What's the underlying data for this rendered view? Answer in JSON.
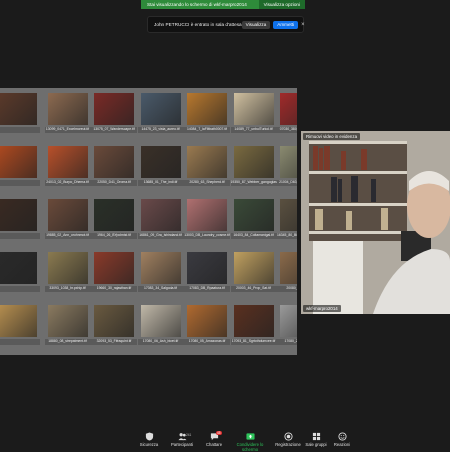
{
  "share_banner": {
    "status_text": "Stai visualizzando lo schermo di wkf-marpro2014",
    "options_label": "Visualizza opzioni"
  },
  "toast": {
    "message": "John PETRUCCI è entrato in sala d'attesa",
    "view_label": "Visualizza",
    "admit_label": "Ammetti",
    "close_glyph": "×"
  },
  "shared_screen": {
    "thumbnails": [
      {
        "cap": "",
        "stars": "",
        "color": "#5c3a2a"
      },
      {
        "cap": "13099_0471_Excelmoreut.tif",
        "stars": "",
        "color": "#8c6a50"
      },
      {
        "cap": "13075_07_Wanderscape.tif",
        "stars": "",
        "color": "#7a2a26"
      },
      {
        "cap": "14475_23_vista_aureo.tif",
        "stars": "",
        "color": "#4a5a6a"
      },
      {
        "cap": "14084_7_laFlitbath0007.tif",
        "stars": "",
        "color": "#b8782e"
      },
      {
        "cap": "14089_77_unbulTurkol.tif",
        "stars": "",
        "color": "#d0c0a0"
      },
      {
        "cap": "07030_380_UFGheoelin.tif",
        "stars": "",
        "color": "#a02a2a"
      },
      {
        "cap": "",
        "stars": "",
        "color": "#b04a20"
      },
      {
        "cap": "24013_02_Burpo_Dhema.tif",
        "stars": "",
        "color": "#b8502a"
      },
      {
        "cap": "22050_D41_Oroma.tif",
        "stars": "",
        "color": "#6a4a3a"
      },
      {
        "cap": "13685_01_The_indi.tif",
        "stars": "",
        "color": "#3a3028"
      },
      {
        "cap": "20280_63_Shepherd.tif",
        "stars": "",
        "color": "#9a7a50"
      },
      {
        "cap": "19350_87_Webber_gangoglas.tif",
        "stars": "",
        "color": "#7a6a40"
      },
      {
        "cap": "21004_D63_Kingpotmatc.tif",
        "stars": "",
        "color": "#8a8a70"
      },
      {
        "cap": "",
        "stars": "",
        "color": "#3a2a22"
      },
      {
        "cap": "19885_02_Ann_orohnmot.tif",
        "stars": "",
        "color": "#6a4a3a"
      },
      {
        "cap": "1964_26_BYpolmist.tif",
        "stars": "",
        "color": "#2a3028"
      },
      {
        "cap": "16861_09_Gra_ishindand.tif",
        "stars": "",
        "color": "#6a4a4a"
      },
      {
        "cap": "13003_DB_Laundry_cosme.tif",
        "stars": "",
        "color": "#b07070"
      },
      {
        "cap": "16403_84_Coltamanigal.tif",
        "stars": "",
        "color": "#3a4a38"
      },
      {
        "cap": "16345_80_Bloom_openhenge.tif",
        "stars": "",
        "color": "#5a5040"
      },
      {
        "cap": "",
        "stars": "",
        "color": "#2a2a2a"
      },
      {
        "cap": "33093_1038_hr.pxhip.tif",
        "stars": "",
        "color": "#8a7a50"
      },
      {
        "cap": "19660_30_rajasthan.tif",
        "stars": "",
        "color": "#8a3a2a"
      },
      {
        "cap": "17083_34_Salgoda.tif",
        "stars": "",
        "color": "#a08060"
      },
      {
        "cap": "17083_DB_Rpaatura.tif",
        "stars": "",
        "color": "#3a3a40"
      },
      {
        "cap": "20003_46_Prop_Sat.tif",
        "stars": "",
        "color": "#c0a060"
      },
      {
        "cap": "20080_02_OAP.tif",
        "stars": "",
        "color": "#8a6a4a"
      },
      {
        "cap": "",
        "stars": "",
        "color": "#b89050"
      },
      {
        "cap": "18880_08_strepatment.tif",
        "stars": "",
        "color": "#8a7a60"
      },
      {
        "cap": "32093_53_Fifraquint.tif",
        "stars": "",
        "color": "#6a5a40"
      },
      {
        "cap": "17080_06_Ash_bicet.tif",
        "stars": "",
        "color": "#c0b8a8"
      },
      {
        "cap": "17080_05_Amazonas.tif",
        "stars": "",
        "color": "#b06a30"
      },
      {
        "cap": "17093_81_Sgrtothdumcee.tif",
        "stars": "",
        "color": "#5a3020"
      },
      {
        "cap": "17080_26_Nuchel.tif",
        "stars": "",
        "color": "#9a9a9a"
      }
    ]
  },
  "video_tile": {
    "label": "Rimuovi video in evidenza",
    "name": "wkf-marpro2014"
  },
  "toolbar": {
    "items": [
      {
        "label": "Sicurezza",
        "icon": "shield-icon"
      },
      {
        "label": "Partecipanti",
        "icon": "participants-icon",
        "count": "241"
      },
      {
        "label": "Chattare",
        "icon": "chat-icon",
        "badge": "45"
      },
      {
        "label": "Condividere lo schermo",
        "icon": "share-screen-icon"
      },
      {
        "label": "Registrazione",
        "icon": "record-icon"
      },
      {
        "label": "Sale gruppi",
        "icon": "breakout-rooms-icon"
      },
      {
        "label": "Reazioni",
        "icon": "reactions-icon"
      }
    ]
  }
}
